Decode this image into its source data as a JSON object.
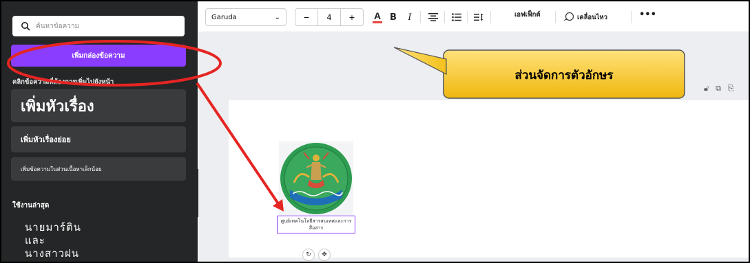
{
  "sidebar": {
    "search_placeholder": "ค้นหาข้อความ",
    "add_textbox_label": "เพิ่มกล่องข้อความ",
    "hint": "คลิกข้อความที่ต้องการเพิ่มไปยังหน้า",
    "heading_label": "เพิ่มหัวเรื่อง",
    "subheading_label": "เพิ่มหัวเรื่องย่อย",
    "body_label": "เพิ่มข้อความในส่วนเนื้อหาเล็กน้อย",
    "recent_label": "ใช้งานล่าสุด",
    "recent_text": [
      "นายมาร์ติน",
      "และ",
      "นางสาวฝน"
    ],
    "collapse_icon": "chevron-left-icon"
  },
  "toolbar": {
    "font_name": "Garuda",
    "font_size": "4",
    "minus": "−",
    "plus": "+",
    "color_letter": "A",
    "bold": "B",
    "italic": "I",
    "effects_label": "เอฟเฟ็กต์",
    "animate_label": "เคลื่อนไหว",
    "more": "•••",
    "accent": "#8b3dff",
    "color_underline": "#e8423b"
  },
  "canvas": {
    "caption": "ศูนย์เทคโนโลยีสารสนเทศและการสื่อสาร",
    "logo_ring_text": "กรมส่งเสริมสหกรณ์"
  },
  "callout": {
    "text": "ส่วนจัดการตัวอักษร",
    "fill": "#f5c21a",
    "highlight_color": "#e52522"
  }
}
